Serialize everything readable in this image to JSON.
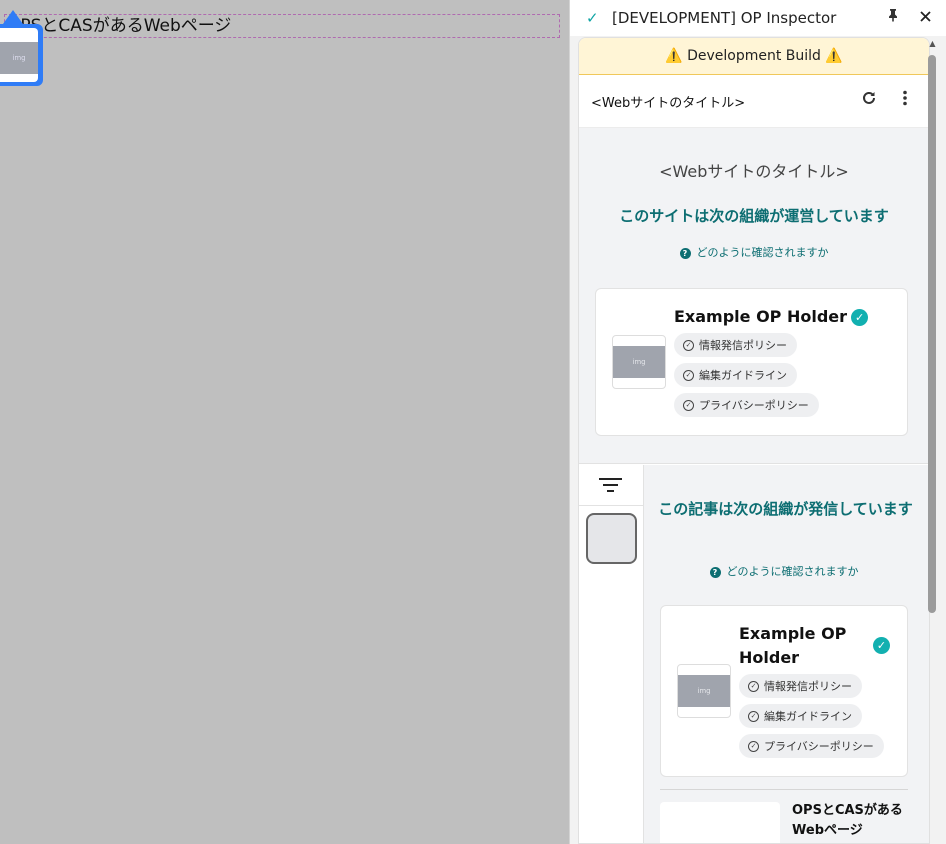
{
  "page": {
    "heading": "OPSとCASがあるWebページ",
    "badge_image_label": "img"
  },
  "panel": {
    "window_title": "[DEVELOPMENT] OP Inspector",
    "dev_banner": "⚠️ Development Build ⚠️",
    "header_title": "<Webサイトのタイトル>",
    "site": {
      "title": "<Webサイトのタイトル>",
      "operator_heading": "このサイトは次の組織が運営しています",
      "how_link": "どのように確認されますか",
      "org": {
        "name": "Example OP Holder",
        "image_label": "img",
        "chips": [
          "情報発信ポリシー",
          "編集ガイドライン",
          "プライバシーポリシー"
        ]
      }
    },
    "article": {
      "operator_heading": "この記事は次の組織が発信しています",
      "how_link": "どのように確認されますか",
      "org": {
        "name": "Example OP Holder",
        "image_label": "img",
        "chips": [
          "情報発信ポリシー",
          "編集ガイドライン",
          "プライバシーポリシー"
        ]
      },
      "next_item_title": "OPSとCASがあるWebページ"
    }
  },
  "colors": {
    "accent_teal": "#0d6e72",
    "verified": "#12b0b0",
    "dev_banner_bg": "#fff5d6",
    "page_badge": "#2f7cf6"
  },
  "icons": {
    "pin": "pin-icon",
    "close": "close-icon",
    "reload": "reload-icon",
    "menu": "more-vertical-icon",
    "filter": "filter-icon",
    "verified": "verified-check-icon",
    "help": "help-circle-icon",
    "check": "check-circle-icon"
  }
}
